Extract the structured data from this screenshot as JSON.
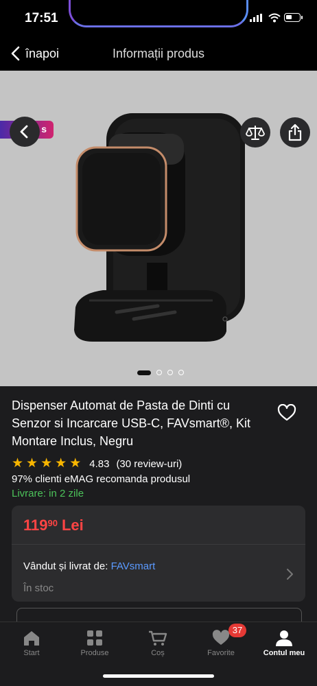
{
  "status_bar": {
    "time": "17:51"
  },
  "nav": {
    "back_label": "înapoi",
    "title": "Informații produs"
  },
  "gallery": {
    "promo_text": "s",
    "image_count": 4,
    "active_index": 0
  },
  "product": {
    "title": "Dispenser Automat de Pasta de Dinti cu Senzor si Incarcare USB-C, FAVsmart®, Kit Montare Inclus, Negru",
    "rating": "4.83",
    "reviews": "(30 review-uri)",
    "stars": 5,
    "recommend": "97% clienti eMAG recomanda produsul",
    "delivery": "Livrare: in 2 zile"
  },
  "offer": {
    "price_int": "119",
    "price_dec": "90",
    "currency": "Lei",
    "sold_by_label": "Vândut și livrat de:",
    "seller": "FAVsmart",
    "stock": "În stoc"
  },
  "tabs": [
    {
      "label": "Start",
      "icon": "home-icon"
    },
    {
      "label": "Produse",
      "icon": "grid-icon"
    },
    {
      "label": "Coș",
      "icon": "cart-icon"
    },
    {
      "label": "Favorite",
      "icon": "heart-icon",
      "badge": "37"
    },
    {
      "label": "Contul meu",
      "icon": "user-icon",
      "active": true
    }
  ],
  "colors": {
    "price": "#ff4444",
    "delivery": "#4cc35a",
    "seller_link": "#5b9aff",
    "star": "#f7b500",
    "badge": "#e53935"
  }
}
